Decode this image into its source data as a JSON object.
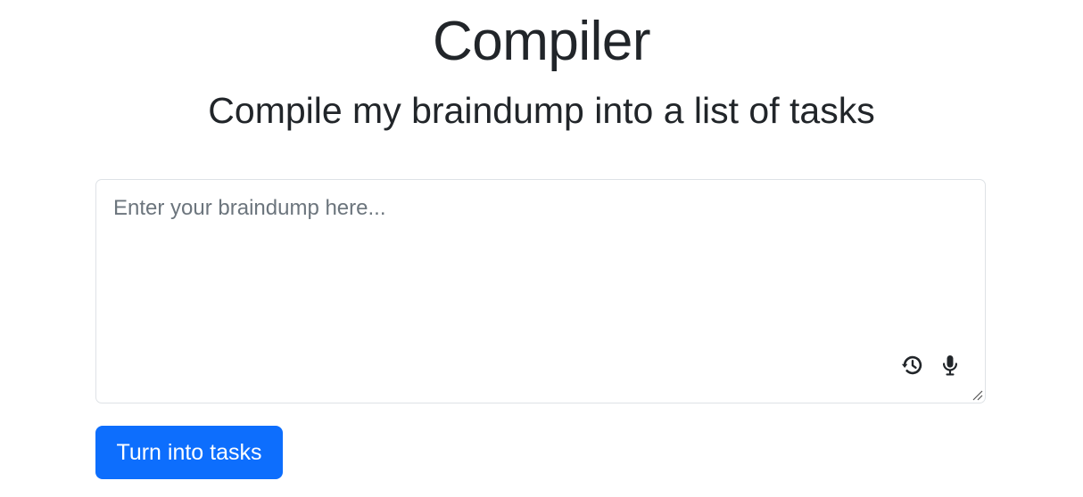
{
  "header": {
    "title": "Compiler",
    "subtitle": "Compile my braindump into a list of tasks"
  },
  "editor": {
    "value": "",
    "placeholder": "Enter your braindump here...",
    "icons": [
      "history-icon",
      "microphone-icon",
      "resize-handle-icon"
    ]
  },
  "actions": {
    "submit_label": "Turn into tasks"
  },
  "colors": {
    "primary": "#0d6efd",
    "text": "#212529",
    "placeholder": "#6c757d",
    "border": "#dee2e6"
  }
}
